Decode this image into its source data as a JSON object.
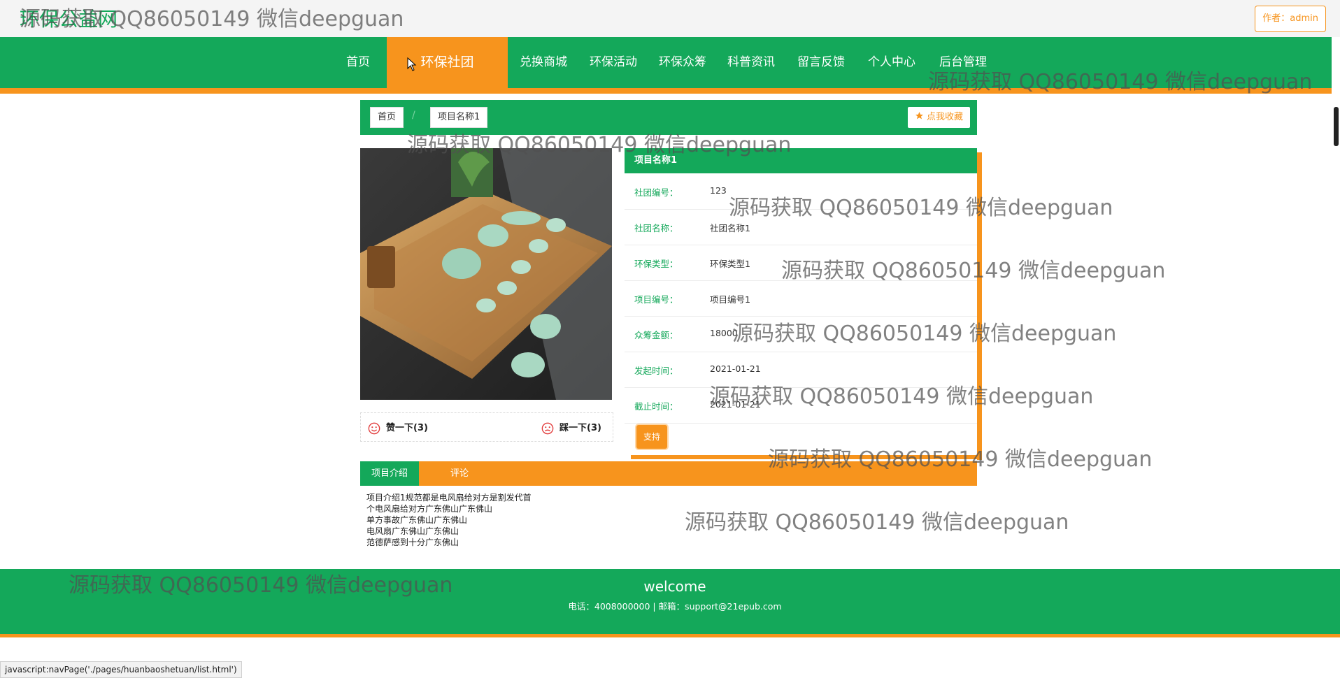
{
  "header": {
    "site_title": "环保公益网",
    "author_badge": "作者：admin"
  },
  "nav": {
    "items": [
      {
        "label": "首页"
      },
      {
        "label": "环保社团",
        "active": true
      },
      {
        "label": "兑换商城"
      },
      {
        "label": "环保活动"
      },
      {
        "label": "环保众筹"
      },
      {
        "label": "科普资讯"
      },
      {
        "label": "留言反馈"
      },
      {
        "label": "个人中心"
      },
      {
        "label": "后台管理"
      }
    ]
  },
  "breadcrumb": {
    "home": "首页",
    "separator": "/",
    "current": "项目名称1",
    "favorite_button": "点我收藏"
  },
  "votes": {
    "like": "赞一下(3)",
    "dislike": "踩一下(3)"
  },
  "detail": {
    "title": "项目名称1",
    "rows": [
      {
        "label": "社团编号：",
        "value": "123"
      },
      {
        "label": "社团名称：",
        "value": "社团名称1"
      },
      {
        "label": "环保类型：",
        "value": "环保类型1"
      },
      {
        "label": "项目编号：",
        "value": "项目编号1"
      },
      {
        "label": "众筹金额：",
        "value": "18000"
      },
      {
        "label": "发起时间：",
        "value": "2021-01-21"
      },
      {
        "label": "截止时间：",
        "value": "2021-01-21"
      }
    ],
    "support_button": "支持"
  },
  "tabs": {
    "items": [
      {
        "label": "项目介绍",
        "active": true
      },
      {
        "label": "评论"
      }
    ]
  },
  "intro": {
    "lines": [
      "项目介绍1规范都是电风扇给对方是割发代首",
      "个电风扇给对方广东佛山广东佛山",
      "单方事故广东佛山广东佛山",
      "电风扇广东佛山广东佛山",
      "范德萨感到十分广东佛山"
    ]
  },
  "footer": {
    "welcome": "welcome",
    "contact": "电话：4008000000 | 邮箱：support@21epub.com"
  },
  "status_bar": {
    "url": "javascript:navPage('./pages/huanbaoshetuan/list.html')"
  },
  "watermark": {
    "text": "源码获取 QQ86050149 微信deepguan"
  },
  "colors": {
    "primary_green": "#14a85a",
    "accent_orange": "#f7941d"
  },
  "icons": [
    "star-icon",
    "smile-icon",
    "sad-icon",
    "cursor-icon"
  ]
}
